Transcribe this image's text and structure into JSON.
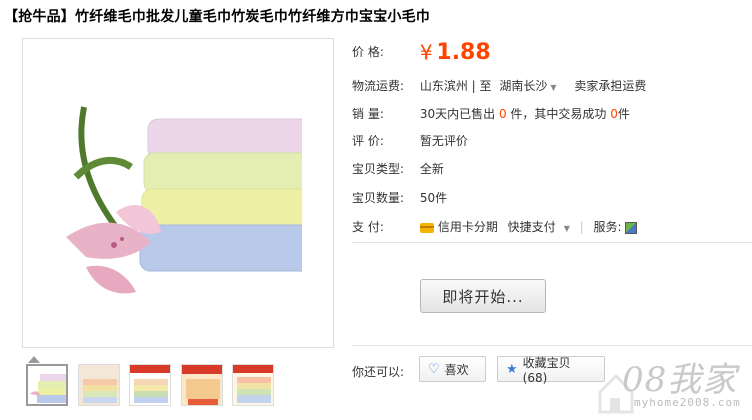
{
  "product": {
    "title": "【抢牛品】竹纤维毛巾批发儿童毛巾竹炭毛巾竹纤维方巾宝宝小毛巾"
  },
  "price": {
    "label": "价      格:",
    "symbol": "¥",
    "value": "1.88"
  },
  "shipping": {
    "label": "物流运费:",
    "from": "山东滨州",
    "to_prefix": "| 至",
    "to": "湖南长沙",
    "note": "卖家承担运费"
  },
  "sales": {
    "label": "销      量:",
    "prefix": "30天内已售出",
    "sold": "0",
    "mid": "件，其中交易成功",
    "success": "0",
    "suffix": "件"
  },
  "review": {
    "label": "评      价:",
    "value": "暂无评价"
  },
  "item_type": {
    "label": "宝贝类型:",
    "value": "全新"
  },
  "item_qty": {
    "label": "宝贝数量:",
    "value": "50件"
  },
  "payment": {
    "label": "支      付:",
    "credit": "信用卡分期",
    "quick": "快捷支付",
    "service_label": "服务:"
  },
  "actions": {
    "buy_label": "即将开始...",
    "you_can": "你还可以:",
    "like_label": "喜欢",
    "fav_label": "收藏宝贝 (68)"
  },
  "watermark": {
    "main": "08我家",
    "sub": "myhome2008.com"
  },
  "colors": {
    "accent": "#ff4400",
    "link_blue": "#3a7fd5"
  }
}
